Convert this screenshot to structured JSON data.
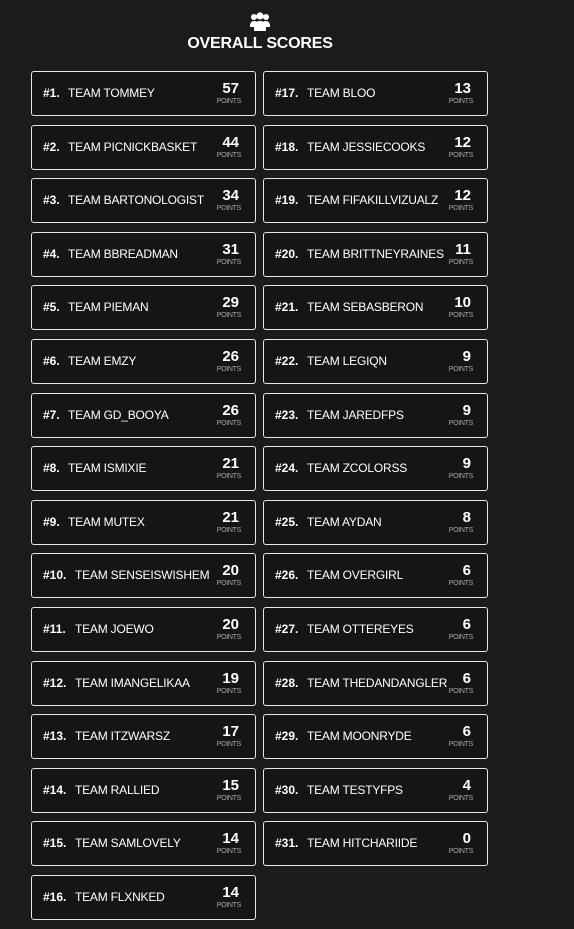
{
  "header": {
    "icon": "users-group-icon",
    "title": "OVERALL SCORES"
  },
  "points_label": "POINTS",
  "colors": {
    "background": "#1b1b1b",
    "card_background": "#151515",
    "card_border": "#e6e6e6",
    "text": "#ffffff",
    "muted_text": "#a9a9a9"
  },
  "columns": [
    {
      "teams": [
        {
          "rank": "#1.",
          "name": "TEAM TOMMEY",
          "points": "57"
        },
        {
          "rank": "#2.",
          "name": "TEAM PICNICKBASKET",
          "points": "44"
        },
        {
          "rank": "#3.",
          "name": "TEAM BARTONOLOGIST",
          "points": "34"
        },
        {
          "rank": "#4.",
          "name": "TEAM BBREADMAN",
          "points": "31"
        },
        {
          "rank": "#5.",
          "name": "TEAM PIEMAN",
          "points": "29"
        },
        {
          "rank": "#6.",
          "name": "TEAM EMZY",
          "points": "26"
        },
        {
          "rank": "#7.",
          "name": "TEAM GD_BOOYA",
          "points": "26"
        },
        {
          "rank": "#8.",
          "name": "TEAM ISMIXIE",
          "points": "21"
        },
        {
          "rank": "#9.",
          "name": "TEAM MUTEX",
          "points": "21"
        },
        {
          "rank": "#10.",
          "name": "TEAM SENSEISWISHEM",
          "points": "20"
        },
        {
          "rank": "#11.",
          "name": "TEAM JOEWO",
          "points": "20"
        },
        {
          "rank": "#12.",
          "name": "TEAM IMANGELIKAA",
          "points": "19"
        },
        {
          "rank": "#13.",
          "name": "TEAM ITZWARSZ",
          "points": "17"
        },
        {
          "rank": "#14.",
          "name": "TEAM RALLIED",
          "points": "15"
        },
        {
          "rank": "#15.",
          "name": "TEAM SAMLOVELY",
          "points": "14"
        },
        {
          "rank": "#16.",
          "name": "TEAM FLXNKED",
          "points": "14"
        }
      ]
    },
    {
      "teams": [
        {
          "rank": "#17.",
          "name": "TEAM BLOO",
          "points": "13"
        },
        {
          "rank": "#18.",
          "name": "TEAM JESSIECOOKS",
          "points": "12"
        },
        {
          "rank": "#19.",
          "name": "TEAM FIFAKILLVIZUALZ",
          "points": "12"
        },
        {
          "rank": "#20.",
          "name": "TEAM BRITTNEYRAINES",
          "points": "11"
        },
        {
          "rank": "#21.",
          "name": "TEAM SEBASBERON",
          "points": "10"
        },
        {
          "rank": "#22.",
          "name": "TEAM LEGIQN",
          "points": "9"
        },
        {
          "rank": "#23.",
          "name": "TEAM JAREDFPS",
          "points": "9"
        },
        {
          "rank": "#24.",
          "name": "TEAM ZCOLORSS",
          "points": "9"
        },
        {
          "rank": "#25.",
          "name": "TEAM AYDAN",
          "points": "8"
        },
        {
          "rank": "#26.",
          "name": "TEAM OVERGIRL",
          "points": "6"
        },
        {
          "rank": "#27.",
          "name": "TEAM OTTEREYES",
          "points": "6"
        },
        {
          "rank": "#28.",
          "name": "TEAM THEDANDANGLER",
          "points": "6"
        },
        {
          "rank": "#29.",
          "name": "TEAM MOONRYDE",
          "points": "6"
        },
        {
          "rank": "#30.",
          "name": "TEAM TESTYFPS",
          "points": "4"
        },
        {
          "rank": "#31.",
          "name": "TEAM HITCHARIIDE",
          "points": "0"
        }
      ]
    }
  ]
}
